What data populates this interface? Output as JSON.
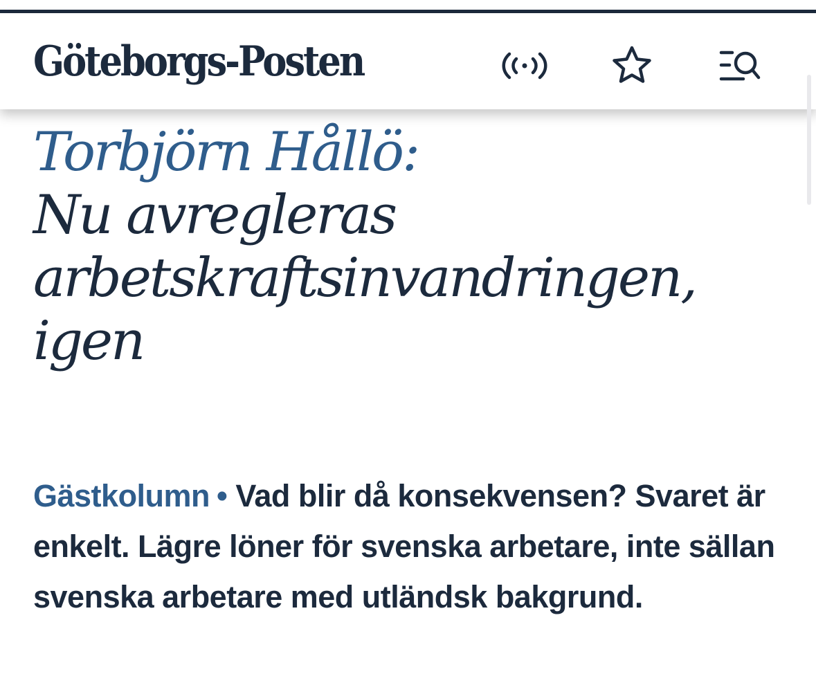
{
  "header": {
    "logo": "Göteborgs-Posten",
    "icons": [
      "live-radio-icon",
      "star-icon",
      "menu-search-icon"
    ]
  },
  "article": {
    "author": "Torbjörn Hållö:",
    "title_line1": "Nu avregleras",
    "title_line2": "arbetskraftsinvandringen,",
    "title_line3": "igen",
    "section": "Gästkolumn",
    "separator": "•",
    "lead": "Vad blir då konsekvensen? Svaret är enkelt. Lägre löner för svenska arbetare, inte sällan svenska arbetare med utländsk bakgrund."
  },
  "colors": {
    "primary": "#1c2a3d",
    "accent": "#2f5d8c",
    "background": "#ffffff"
  }
}
